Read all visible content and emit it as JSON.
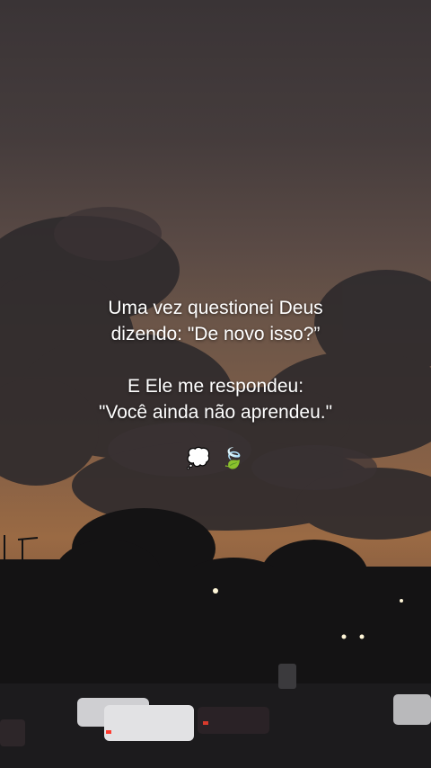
{
  "caption": {
    "line1": "Uma vez questionei Deus",
    "line2": "dizendo: \"De novo isso?”",
    "line3": "E Ele me respondeu:",
    "line4": "\"Você ainda não aprendeu.\""
  },
  "emojis": {
    "thought": "💭",
    "leaf": "🍃"
  },
  "colors": {
    "text": "#ffffff",
    "sky_top": "#3a3436",
    "sunset_glow": "#9a6a44",
    "ground": "#1e1c1e"
  }
}
